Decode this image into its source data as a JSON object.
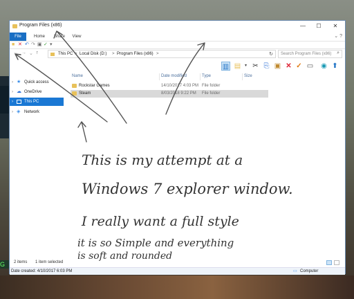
{
  "window": {
    "title": "Program Files (x86)",
    "controls": {
      "minimize": "—",
      "maximize": "☐",
      "close": "✕"
    }
  },
  "ribbon": {
    "tabs": [
      "File",
      "Home",
      "Share",
      "View"
    ],
    "help_icons": "⌄ ?"
  },
  "address": {
    "crumbs": [
      "This PC",
      ">",
      "Local Disk (D:)",
      ">",
      "Program Files (x86)",
      ">"
    ],
    "search_placeholder": "Search Program Files (x86)"
  },
  "nav": {
    "items": [
      {
        "label": "Quick access",
        "icon": "star-icon",
        "color": "#3c8ee8"
      },
      {
        "label": "OneDrive",
        "icon": "cloud-icon",
        "color": "#2b6fd6"
      },
      {
        "label": "This PC",
        "icon": "computer-icon",
        "color": "#ffffff",
        "selected": true
      },
      {
        "label": "Network",
        "icon": "network-icon",
        "color": "#3c8ee8"
      }
    ]
  },
  "columns": [
    "Name",
    "Date modified",
    "Type",
    "Size"
  ],
  "files": [
    {
      "name": "Rockstar Games",
      "date": "14/10/2017 4:03 PM",
      "type": "File folder",
      "size": ""
    },
    {
      "name": "Steam",
      "date": "8/03/2018 9:22 PM",
      "type": "File folder",
      "size": "",
      "selected": true
    }
  ],
  "status": {
    "items": "2 items",
    "selected": "1 item selected"
  },
  "details": {
    "date_created": "Date created: 4/10/2017 6:03 PM",
    "location": "Computer"
  },
  "annotation": {
    "lines": [
      "This is my attempt at a",
      "Windows 7 explorer window.",
      "I really want a full style",
      "it is so Simple and everything",
      "is soft and rounded"
    ]
  },
  "colors": {
    "accent": "#1a78d4",
    "folder": "#e8c15a",
    "selected_row": "#d9d9d9"
  }
}
